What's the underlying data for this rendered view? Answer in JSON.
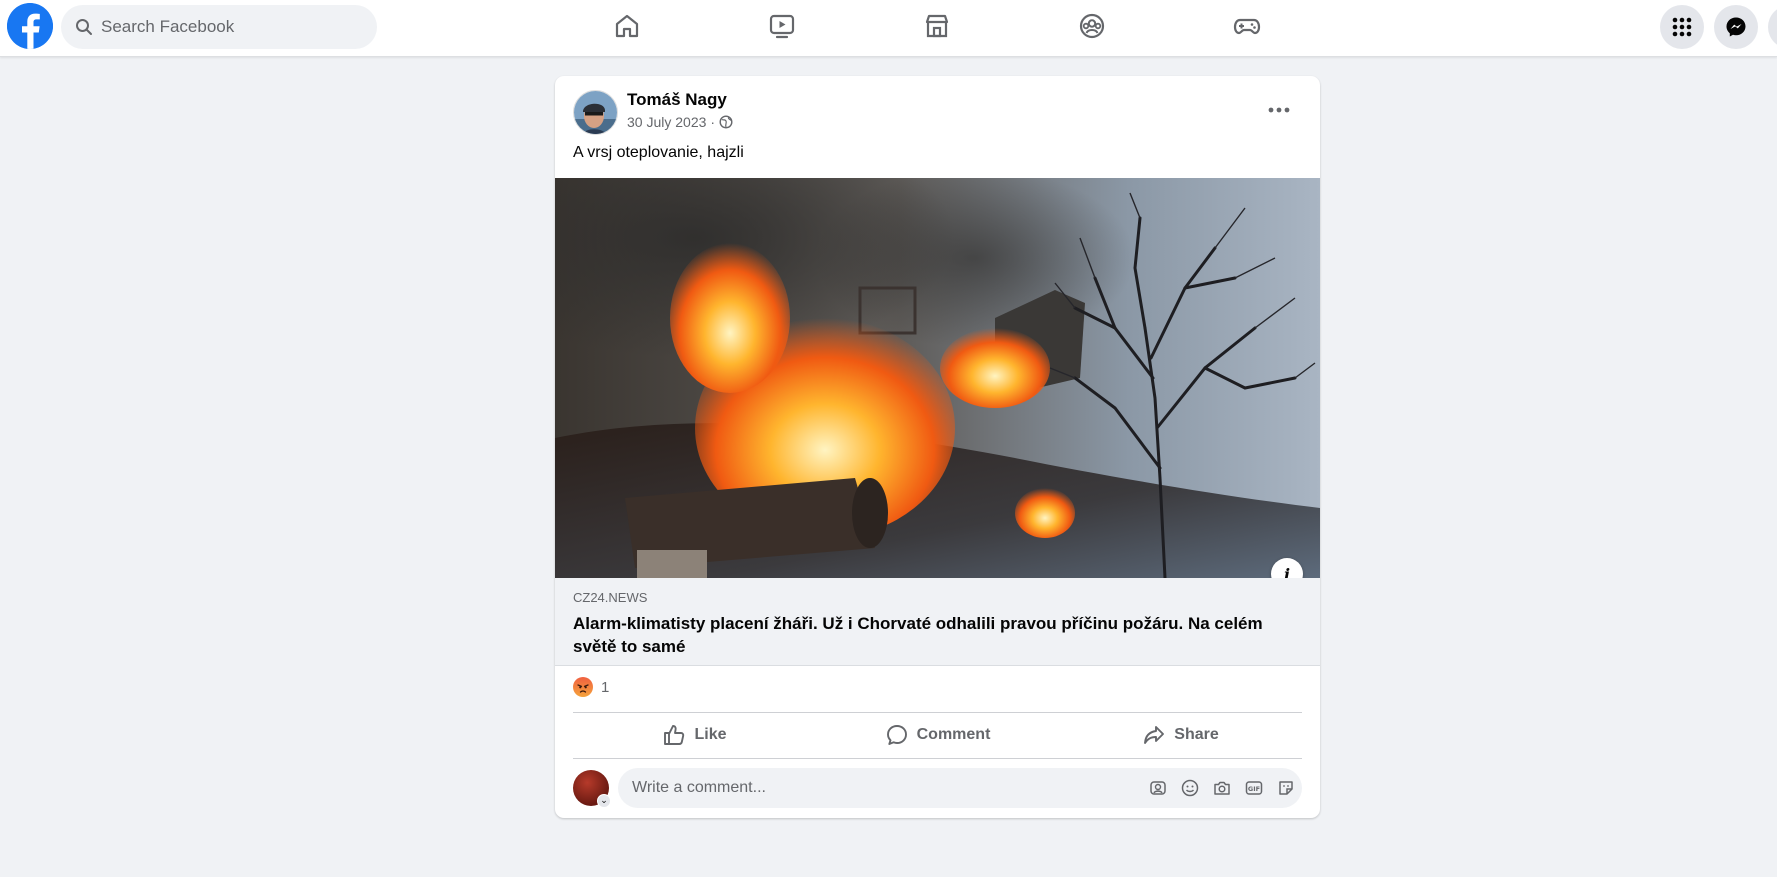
{
  "topbar": {
    "logo_icon": "facebook-logo-icon",
    "search_placeholder": "Search Facebook",
    "nav": [
      {
        "name": "home-icon"
      },
      {
        "name": "watch-icon"
      },
      {
        "name": "marketplace-icon"
      },
      {
        "name": "groups-icon"
      },
      {
        "name": "gaming-icon"
      }
    ],
    "right": [
      {
        "name": "menu-grid-icon"
      },
      {
        "name": "messenger-icon"
      }
    ]
  },
  "post": {
    "author": "Tomáš Nagy",
    "date": "30 July 2023",
    "date_separator": "·",
    "privacy_icon": "globe-icon",
    "text": "A vrsj oteplovanie, hajzli",
    "link": {
      "domain": "CZ24.NEWS",
      "title": "Alarm-klimatisty placení žháři. Už i Chorvaté odhalili pravou příčinu požáru. Na celém světě to samé"
    },
    "reactions": {
      "type": "angry-reaction-icon",
      "count": "1"
    },
    "actions": {
      "like": "Like",
      "comment": "Comment",
      "share": "Share"
    },
    "comment_box": {
      "placeholder": "Write a comment...",
      "icons": [
        "avatar-sticker-icon",
        "emoji-icon",
        "camera-icon",
        "gif-icon",
        "sticker-icon"
      ]
    }
  },
  "colors": {
    "brand": "#1877f2",
    "background": "#f0f2f5",
    "secondary_text": "#65676b"
  }
}
